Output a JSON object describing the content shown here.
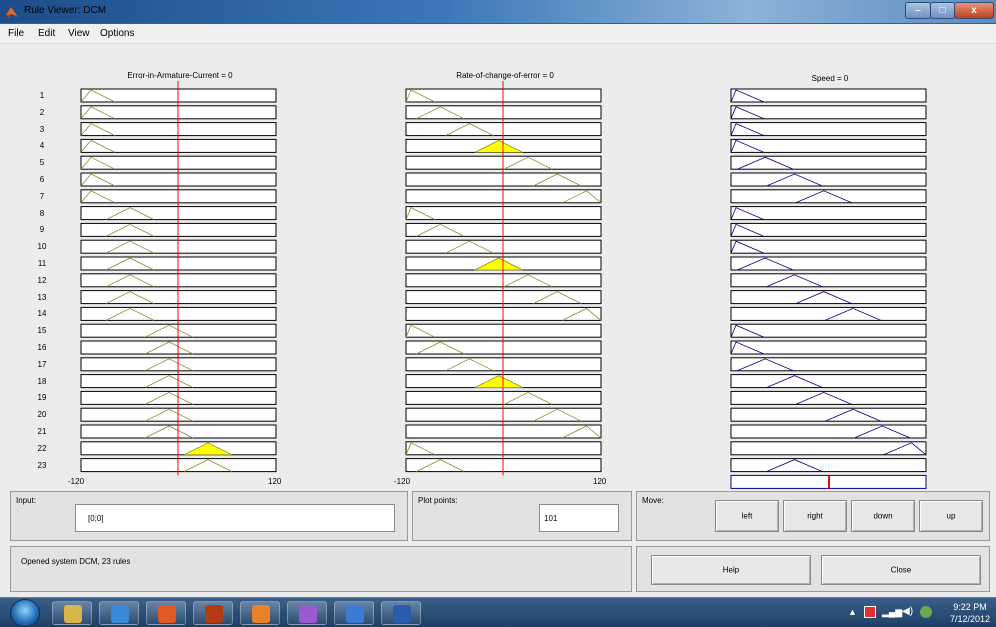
{
  "window": {
    "title": "Rule Viewer: DCM",
    "icon": "matlab-icon",
    "controls": {
      "minimize": "–",
      "maximize": "□",
      "close": "x"
    }
  },
  "menu": {
    "items": [
      "File",
      "Edit",
      "View",
      "Options"
    ]
  },
  "variables": {
    "input1": {
      "title": "Error-in-Armature-Current = 0",
      "range": [
        "-120",
        "120"
      ]
    },
    "input2": {
      "title": "Rate-of-change-of-error = 0",
      "range": [
        "-120",
        "120"
      ]
    },
    "output": {
      "title": "Speed = 0"
    }
  },
  "rules": {
    "count": 23,
    "numbers": [
      "1",
      "2",
      "3",
      "4",
      "5",
      "6",
      "7",
      "8",
      "9",
      "10",
      "11",
      "12",
      "13",
      "14",
      "15",
      "16",
      "17",
      "18",
      "19",
      "20",
      "21",
      "22",
      "23"
    ],
    "input1_mf": [
      1,
      1,
      1,
      1,
      1,
      1,
      1,
      2,
      2,
      2,
      2,
      2,
      2,
      2,
      3,
      3,
      3,
      3,
      3,
      3,
      3,
      4,
      4
    ],
    "input2_mf": [
      1,
      2,
      3,
      4,
      5,
      6,
      7,
      1,
      2,
      3,
      4,
      5,
      6,
      7,
      1,
      2,
      3,
      4,
      5,
      6,
      7,
      1,
      2
    ],
    "output_mf": [
      1,
      1,
      1,
      1,
      2,
      3,
      4,
      1,
      1,
      1,
      2,
      3,
      4,
      5,
      1,
      1,
      2,
      3,
      4,
      5,
      6,
      7,
      3
    ],
    "active_rules": [
      4,
      11,
      18,
      22
    ],
    "input_colors": {
      "mf_line": "#8a8a30",
      "fill": "#ffff00",
      "marker": "#ff0000"
    },
    "output_color": "#00008b"
  },
  "controls": {
    "input_label": "Input:",
    "input_value": "[0;0]",
    "plot_points_label": "Plot points:",
    "plot_points_value": "101",
    "move_label": "Move:",
    "move_buttons": [
      "left",
      "right",
      "down",
      "up"
    ],
    "status": "Opened system DCM, 23 rules",
    "help_label": "Help",
    "close_label": "Close"
  },
  "taskbar": {
    "apps": [
      "windows-explorer",
      "internet-explorer",
      "media-player",
      "matlab",
      "firefox",
      "paint",
      "simulink",
      "word"
    ],
    "clock": {
      "time": "9:22 PM",
      "date": "7/12/2012"
    }
  }
}
